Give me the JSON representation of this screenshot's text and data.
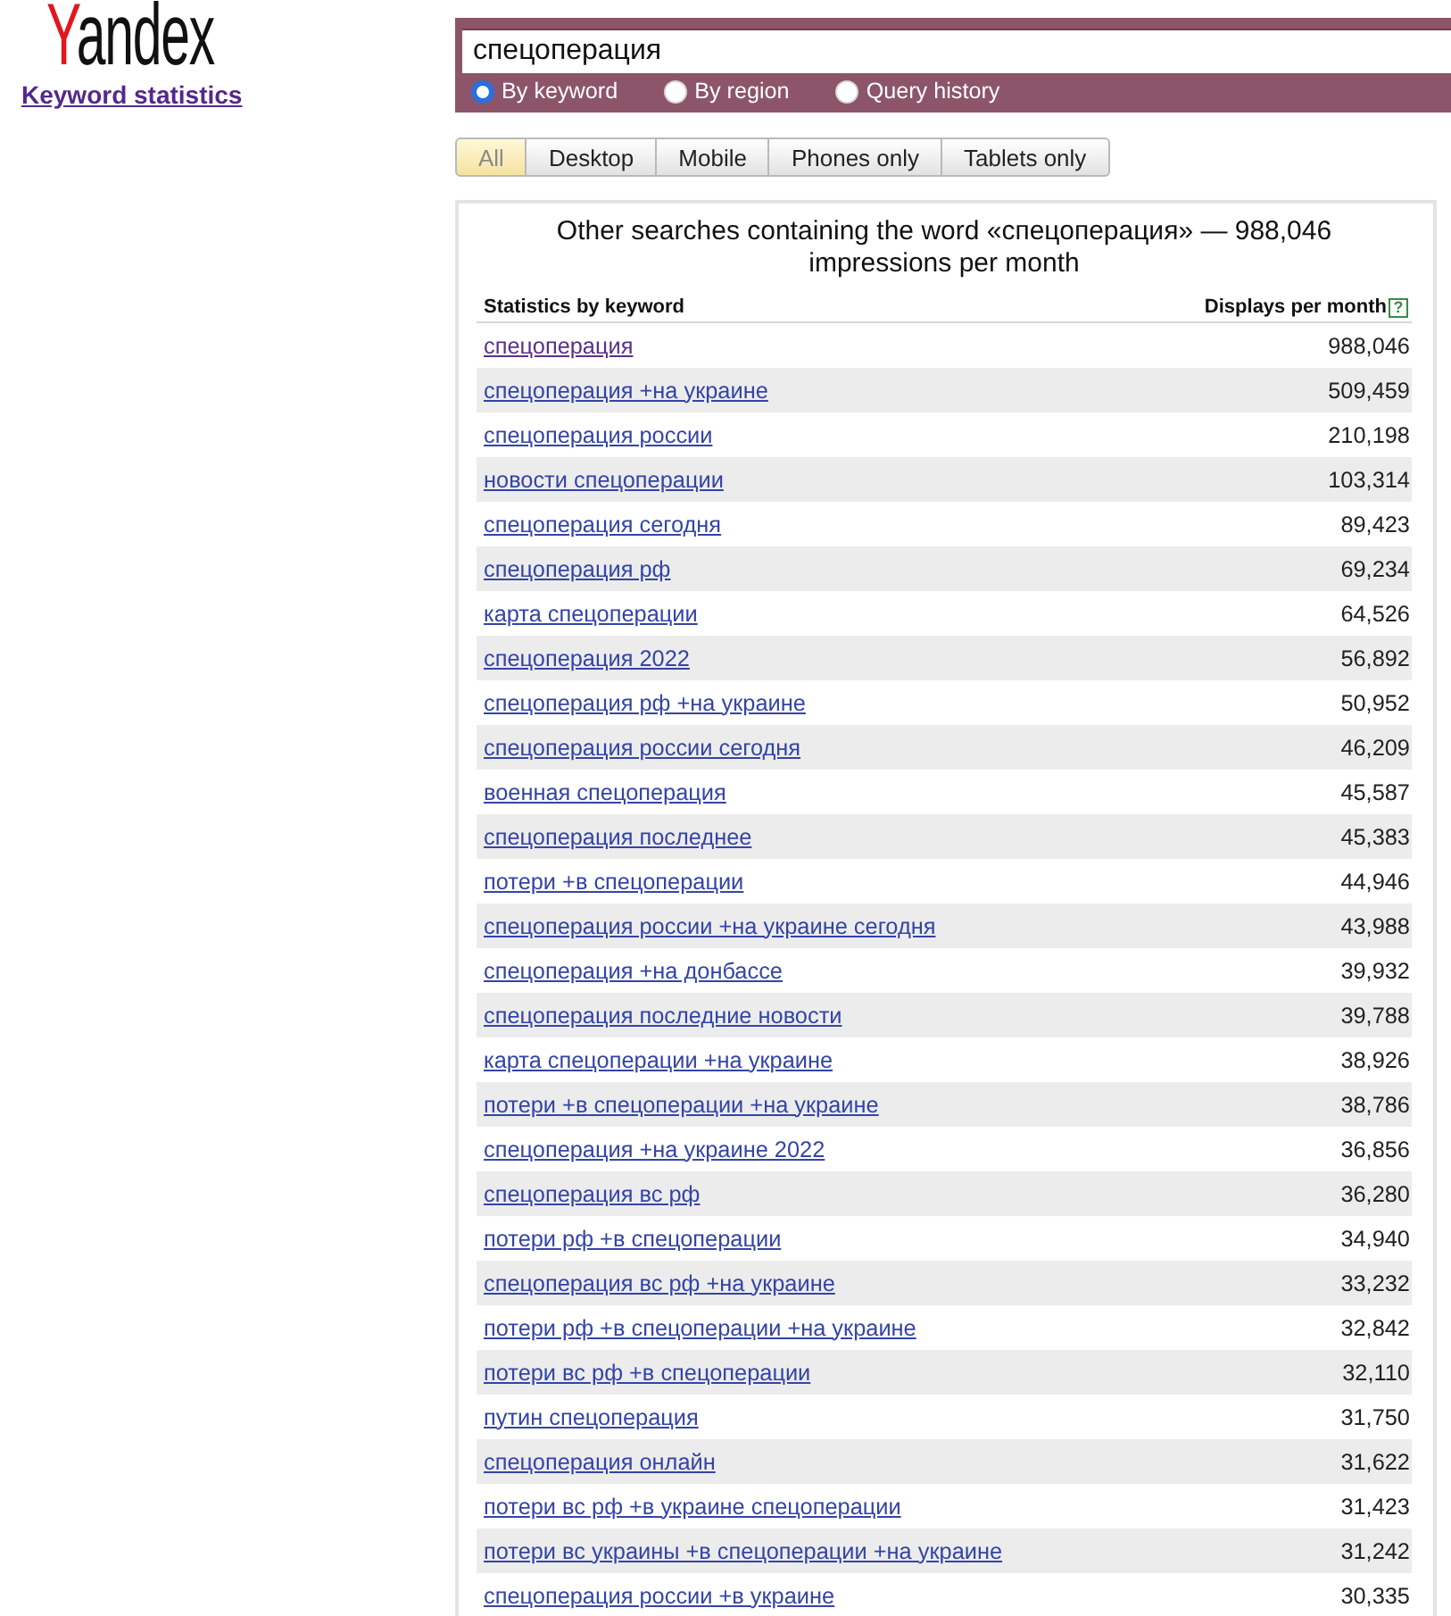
{
  "logo": {
    "text": "Yandex"
  },
  "service_link": {
    "label": "Keyword statistics",
    "visited": true
  },
  "search": {
    "value": "спецоперация",
    "modes": [
      {
        "label": "By keyword",
        "selected": true
      },
      {
        "label": "By region",
        "selected": false
      },
      {
        "label": "Query history",
        "selected": false
      }
    ]
  },
  "device_tabs": [
    {
      "label": "All",
      "selected": true
    },
    {
      "label": "Desktop",
      "selected": false
    },
    {
      "label": "Mobile",
      "selected": false
    },
    {
      "label": "Phones only",
      "selected": false
    },
    {
      "label": "Tablets only",
      "selected": false
    }
  ],
  "results": {
    "title": "Other searches containing the word «спецоперация» — 988,046 impressions per month",
    "columns": [
      "Statistics by keyword",
      "Displays per month"
    ],
    "help_icon": "?",
    "rows": [
      {
        "keyword": "спецоперация",
        "displays": "988,046",
        "visited": true
      },
      {
        "keyword": "спецоперация +на украине",
        "displays": "509,459",
        "visited": false
      },
      {
        "keyword": "спецоперация россии",
        "displays": "210,198",
        "visited": false
      },
      {
        "keyword": "новости спецоперации",
        "displays": "103,314",
        "visited": false
      },
      {
        "keyword": "спецоперация сегодня",
        "displays": "89,423",
        "visited": false
      },
      {
        "keyword": "спецоперация рф",
        "displays": "69,234",
        "visited": false
      },
      {
        "keyword": "карта спецоперации",
        "displays": "64,526",
        "visited": false
      },
      {
        "keyword": "спецоперация 2022",
        "displays": "56,892",
        "visited": false
      },
      {
        "keyword": "спецоперация рф +на украине",
        "displays": "50,952",
        "visited": false
      },
      {
        "keyword": "спецоперация россии сегодня",
        "displays": "46,209",
        "visited": false
      },
      {
        "keyword": "военная спецоперация",
        "displays": "45,587",
        "visited": false
      },
      {
        "keyword": "спецоперация последнее",
        "displays": "45,383",
        "visited": false
      },
      {
        "keyword": "потери +в спецоперации",
        "displays": "44,946",
        "visited": false
      },
      {
        "keyword": "спецоперация россии +на украине сегодня",
        "displays": "43,988",
        "visited": false
      },
      {
        "keyword": "спецоперация +на донбассе",
        "displays": "39,932",
        "visited": false
      },
      {
        "keyword": "спецоперация последние новости",
        "displays": "39,788",
        "visited": false
      },
      {
        "keyword": "карта спецоперации +на украине",
        "displays": "38,926",
        "visited": false
      },
      {
        "keyword": "потери +в спецоперации +на украине",
        "displays": "38,786",
        "visited": false
      },
      {
        "keyword": "спецоперация +на украине 2022",
        "displays": "36,856",
        "visited": false
      },
      {
        "keyword": "спецоперация вс рф",
        "displays": "36,280",
        "visited": false
      },
      {
        "keyword": "потери рф +в спецоперации",
        "displays": "34,940",
        "visited": false
      },
      {
        "keyword": "спецоперация вс рф +на украине",
        "displays": "33,232",
        "visited": false
      },
      {
        "keyword": "потери рф +в спецоперации +на украине",
        "displays": "32,842",
        "visited": false
      },
      {
        "keyword": "потери вс рф +в спецоперации",
        "displays": "32,110",
        "visited": false
      },
      {
        "keyword": "путин спецоперация",
        "displays": "31,750",
        "visited": false
      },
      {
        "keyword": "спецоперация онлайн",
        "displays": "31,622",
        "visited": false
      },
      {
        "keyword": "потери вс рф +в украине спецоперации",
        "displays": "31,423",
        "visited": false
      },
      {
        "keyword": "потери вс украины +в спецоперации +на украине",
        "displays": "31,242",
        "visited": false
      },
      {
        "keyword": "спецоперация россии +в украине",
        "displays": "30,335",
        "visited": false
      }
    ]
  }
}
